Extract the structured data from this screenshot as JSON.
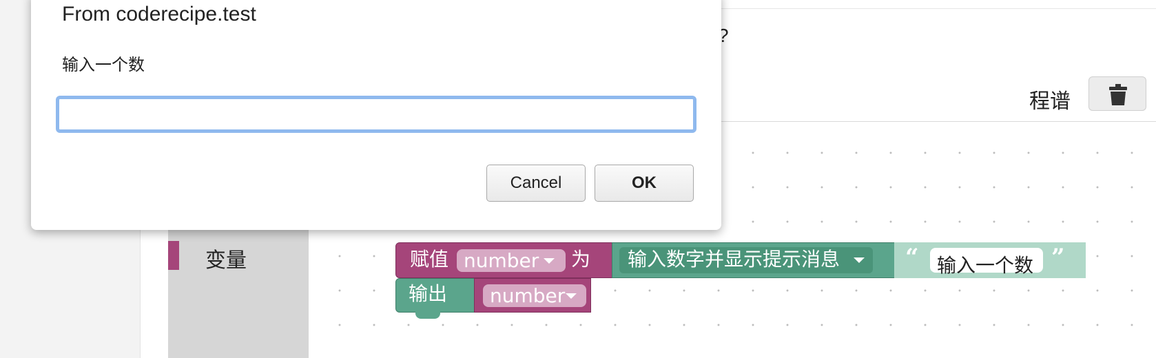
{
  "page": {
    "question_fragment": "?",
    "recipe_label": "程谱"
  },
  "toolbox": {
    "selected_category": {
      "label": "变量",
      "color": "#a5457a"
    }
  },
  "blocks": {
    "assign": {
      "keyword": "赋值",
      "variable": "number",
      "to": "为"
    },
    "prompt": {
      "label": "输入数字并显示提示消息"
    },
    "text": {
      "open_quote": "“",
      "value": "输入一个数",
      "close_quote": "”"
    },
    "print": {
      "keyword": "输出",
      "variable": "number"
    }
  },
  "colors": {
    "variable_block": "#a5457a",
    "io_block": "#5ba58c",
    "text_block": "#b0d8c8",
    "input_focus": "#8fb9ee"
  },
  "dialog": {
    "title": "From coderecipe.test",
    "message": "输入一个数",
    "input_value": "",
    "cancel_label": "Cancel",
    "ok_label": "OK"
  },
  "icons": {
    "trash": "trash-icon"
  }
}
